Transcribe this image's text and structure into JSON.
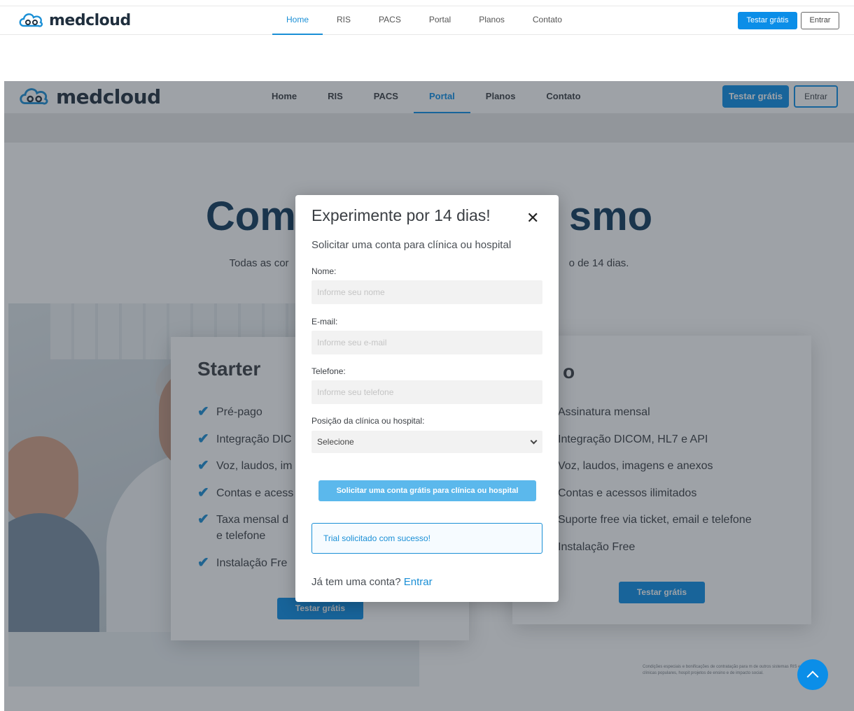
{
  "top_nav": {
    "brand": "medcloud",
    "items": [
      "Home",
      "RIS",
      "PACS",
      "Portal",
      "Planos",
      "Contato"
    ],
    "trial_button": "Testar grátis",
    "login_button": "Entrar"
  },
  "background_page": {
    "nav": {
      "brand": "medcloud",
      "items": [
        "Home",
        "RIS",
        "PACS",
        "Portal",
        "Planos",
        "Contato"
      ],
      "trial_button": "Testar grátis",
      "login_button": "Entrar"
    },
    "hero_left": "Com",
    "hero_right": "smo",
    "subtitle_left": "Todas as cor",
    "subtitle_right": "o de 14 dias.",
    "starter": {
      "title": "Starter",
      "features": [
        "Pré-pago",
        "Integração DIC",
        "Voz, laudos, im",
        "Contas e acess",
        "Taxa mensal d",
        "e telefone",
        "Instalação Fre"
      ],
      "button": "Testar grátis"
    },
    "pro": {
      "title_fragment": "o",
      "features": [
        "Assinatura mensal",
        "Integração DICOM, HL7 e API",
        "Voz, laudos, imagens e anexos",
        "Contas e acessos ilimitados",
        "Suporte free via ticket, email e telefone",
        "Instalação Free"
      ],
      "button": "Testar grátis"
    },
    "disclaimer": "Condições especiais e bonificações de contratação para m de outros sistemas RIS e PACS, clínicas populares, hospit projetos de ensino e de impacto social."
  },
  "modal": {
    "title": "Experimente por 14 dias!",
    "subtitle": "Solicitar uma conta para clínica ou hospital",
    "name_label": "Nome:",
    "name_placeholder": "Informe seu nome",
    "email_label": "E-mail:",
    "email_placeholder": "Informe seu e-mail",
    "phone_label": "Telefone:",
    "phone_placeholder": "Informe seu telefone",
    "position_label": "Posição da clínica ou hospital:",
    "position_value": "Selecione",
    "submit_button": "Solicitar uma conta grátis para clínica ou hospital",
    "success_message": "Trial solicitado com sucesso!",
    "login_prompt": "Já tem uma conta?",
    "login_link": "Entrar"
  },
  "colors": {
    "brand_blue": "#0b8ee8",
    "link_blue": "#1a8fd6",
    "heading_navy": "#0f3a5c"
  }
}
